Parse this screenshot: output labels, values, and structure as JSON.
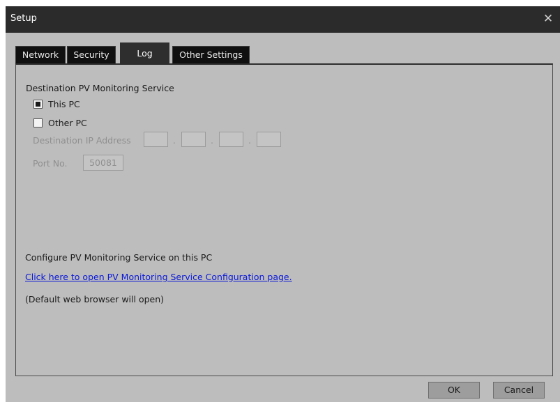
{
  "window": {
    "title": "Setup"
  },
  "tabs": [
    {
      "label": "Network"
    },
    {
      "label": "Security"
    },
    {
      "label": "Log"
    },
    {
      "label": "Other Settings"
    }
  ],
  "active_tab": "Log",
  "destination": {
    "heading": "Destination PV Monitoring Service",
    "this_pc": {
      "label": "This PC",
      "checked": true
    },
    "other_pc": {
      "label": "Other PC",
      "checked": false
    },
    "ip_label": "Destination IP Address",
    "ip_octets": [
      "",
      "",
      "",
      ""
    ],
    "ip_separator": ".",
    "port_label": "Port No.",
    "port_value": "50081"
  },
  "configure": {
    "heading": "Configure PV Monitoring Service on this PC",
    "link_text": "Click here to open PV Monitoring Service Configuration page.",
    "note": "(Default web browser will open)"
  },
  "buttons": {
    "ok": "OK",
    "cancel": "Cancel"
  },
  "colors": {
    "title_bar": "#2b2b2b",
    "dialog_bg": "#bdbdbd",
    "tab_bg": "#101010",
    "active_tab_bg": "#2e2e2e",
    "link": "#0a18d6"
  }
}
